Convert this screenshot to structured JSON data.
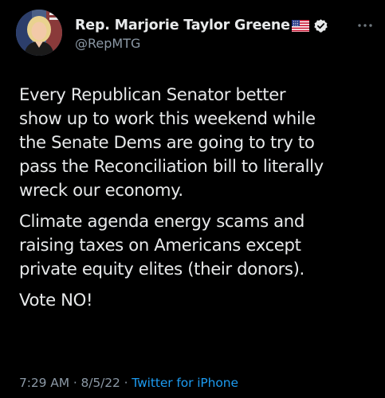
{
  "author": {
    "display_name": "Rep. Marjorie Taylor Greene",
    "handle": "@RepMTG",
    "flag_icon": "us-flag-icon",
    "verified_icon": "verified-badge-icon",
    "avatar_icon": "profile-photo"
  },
  "more_icon": "more-options-icon",
  "tweet": {
    "paragraphs": [
      {
        "lines": [
          "Every Republican Senator better",
          "show up to work this weekend while",
          "the Senate Dems are going to try to",
          "pass the Reconciliation bill to literally",
          "wreck our economy."
        ]
      },
      {
        "lines": [
          "Climate agenda energy scams and",
          "raising taxes on Americans except",
          "private equity elites (their donors)."
        ]
      },
      {
        "lines": [
          "Vote NO!"
        ]
      }
    ]
  },
  "meta": {
    "time": "7:29 AM",
    "separator": " · ",
    "date": "8/5/22",
    "separator2": " · ",
    "source": "Twitter for iPhone"
  },
  "colors": {
    "background": "#000000",
    "text": "#e7e9ea",
    "secondary_text": "#8b98a5",
    "link": "#1d9bf0",
    "verified_badge": "#e7e9ea"
  }
}
